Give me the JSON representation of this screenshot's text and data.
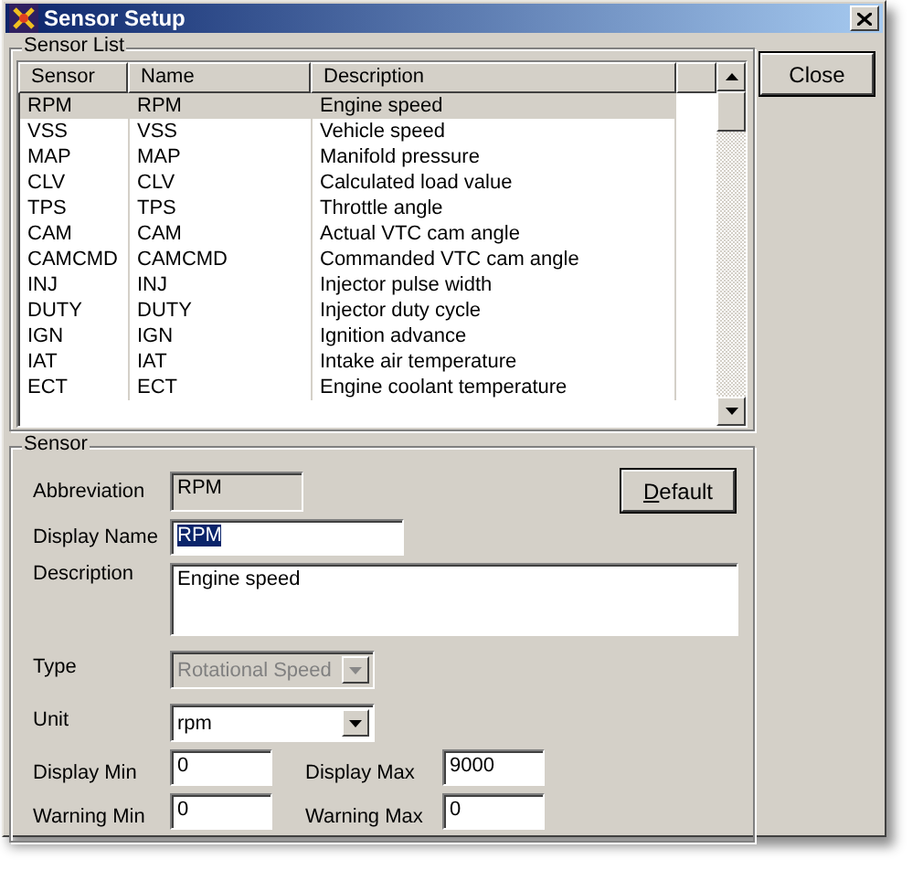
{
  "window": {
    "title": "Sensor Setup"
  },
  "sensor_list": {
    "title": "Sensor List",
    "columns": [
      "Sensor",
      "Name",
      "Description"
    ],
    "rows": [
      {
        "sensor": "RPM",
        "name": "RPM",
        "description": "Engine speed",
        "selected": true
      },
      {
        "sensor": "VSS",
        "name": "VSS",
        "description": "Vehicle speed",
        "selected": false
      },
      {
        "sensor": "MAP",
        "name": "MAP",
        "description": "Manifold pressure",
        "selected": false
      },
      {
        "sensor": "CLV",
        "name": "CLV",
        "description": "Calculated load value",
        "selected": false
      },
      {
        "sensor": "TPS",
        "name": "TPS",
        "description": "Throttle angle",
        "selected": false
      },
      {
        "sensor": "CAM",
        "name": "CAM",
        "description": "Actual VTC cam angle",
        "selected": false
      },
      {
        "sensor": "CAMCMD",
        "name": "CAMCMD",
        "description": "Commanded VTC cam angle",
        "selected": false
      },
      {
        "sensor": "INJ",
        "name": "INJ",
        "description": "Injector pulse width",
        "selected": false
      },
      {
        "sensor": "DUTY",
        "name": "DUTY",
        "description": "Injector duty cycle",
        "selected": false
      },
      {
        "sensor": "IGN",
        "name": "IGN",
        "description": "Ignition advance",
        "selected": false
      },
      {
        "sensor": "IAT",
        "name": "IAT",
        "description": "Intake air temperature",
        "selected": false
      },
      {
        "sensor": "ECT",
        "name": "ECT",
        "description": "Engine coolant temperature",
        "selected": false
      }
    ]
  },
  "close_button": "Close",
  "sensor": {
    "title": "Sensor",
    "abbreviation": {
      "label": "Abbreviation",
      "value": "RPM"
    },
    "default_button": "Default",
    "display_name": {
      "label": "Display Name",
      "value": "RPM"
    },
    "description": {
      "label": "Description",
      "value": "Engine speed"
    },
    "type": {
      "label": "Type",
      "value": "Rotational Speed",
      "disabled": true
    },
    "unit": {
      "label": "Unit",
      "value": "rpm",
      "disabled": false
    },
    "display_min": {
      "label": "Display Min",
      "value": "0"
    },
    "display_max": {
      "label": "Display Max",
      "value": "9000"
    },
    "warning_min": {
      "label": "Warning Min",
      "value": "0"
    },
    "warning_max": {
      "label": "Warning Max",
      "value": "0"
    }
  }
}
